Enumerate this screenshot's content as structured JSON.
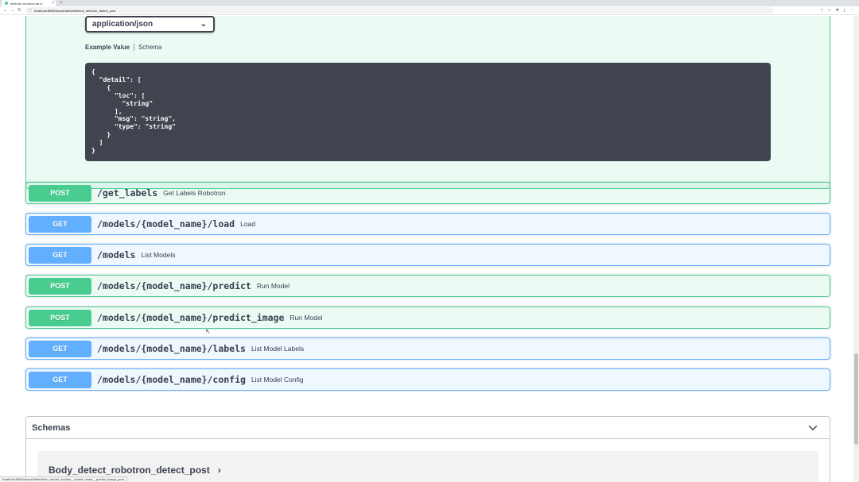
{
  "browser": {
    "tab_title": "detector-robotron.ab.io",
    "tab_close": "×",
    "new_tab": "+",
    "url": "localhost:8080/docs#/default/detect_detector_detect_post",
    "toolbar_icons": [
      "star-icon",
      "extension-icon",
      "puzzle-icon",
      "download-icon",
      "menu-icon"
    ]
  },
  "response_block": {
    "media_type": "application/json",
    "example_tab": "Example Value",
    "schema_tab": "Schema",
    "example_code": "{\n  \"detail\": [\n    {\n      \"loc\": [\n        \"string\"\n      ],\n      \"msg\": \"string\",\n      \"type\": \"string\"\n    }\n  ]\n}"
  },
  "operations": [
    {
      "method": "POST",
      "path": "/get_labels",
      "summary": "Get Labels Robotron"
    },
    {
      "method": "GET",
      "path": "/models/{model_name}/load",
      "summary": "Load"
    },
    {
      "method": "GET",
      "path": "/models",
      "summary": "List Models"
    },
    {
      "method": "POST",
      "path": "/models/{model_name}/predict",
      "summary": "Run Model"
    },
    {
      "method": "POST",
      "path": "/models/{model_name}/predict_image",
      "summary": "Run Model"
    },
    {
      "method": "GET",
      "path": "/models/{model_name}/labels",
      "summary": "List Model Labels"
    },
    {
      "method": "GET",
      "path": "/models/{model_name}/config",
      "summary": "List Model Config"
    }
  ],
  "schemas": {
    "title": "Schemas",
    "models": [
      {
        "name": "Body_detect_robotron_detect_post"
      }
    ]
  },
  "status_bar": "localhost:8080/docs#/default/run_model_models__model_name__predict_image_post",
  "colors": {
    "post": "#49cc90",
    "get": "#61afe",
    "code_bg": "#41444e",
    "text": "#3b4151"
  }
}
